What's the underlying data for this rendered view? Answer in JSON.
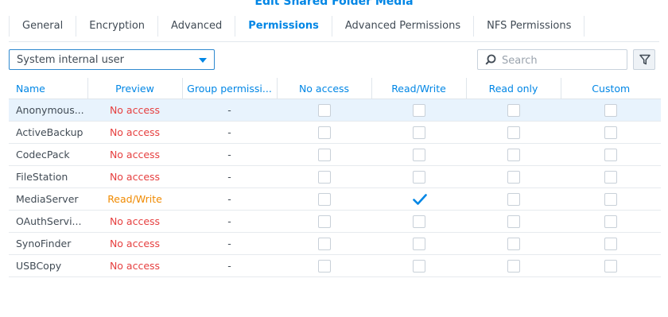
{
  "window": {
    "title": "Edit Shared Folder Media"
  },
  "tabs": [
    {
      "label": "General"
    },
    {
      "label": "Encryption"
    },
    {
      "label": "Advanced"
    },
    {
      "label": "Permissions",
      "active": true
    },
    {
      "label": "Advanced Permissions"
    },
    {
      "label": "NFS Permissions"
    }
  ],
  "toolbar": {
    "user_type": "System internal user",
    "search_placeholder": "Search"
  },
  "table": {
    "columns": [
      "Name",
      "Preview",
      "Group permissi...",
      "No access",
      "Read/Write",
      "Read only",
      "Custom"
    ],
    "rows": [
      {
        "name": "Anonymous...",
        "preview": "No access",
        "group": "-",
        "no_access": false,
        "read_write": false,
        "read_only": false,
        "custom": false
      },
      {
        "name": "ActiveBackup",
        "preview": "No access",
        "group": "-",
        "no_access": false,
        "read_write": false,
        "read_only": false,
        "custom": false
      },
      {
        "name": "CodecPack",
        "preview": "No access",
        "group": "-",
        "no_access": false,
        "read_write": false,
        "read_only": false,
        "custom": false
      },
      {
        "name": "FileStation",
        "preview": "No access",
        "group": "-",
        "no_access": false,
        "read_write": false,
        "read_only": false,
        "custom": false
      },
      {
        "name": "MediaServer",
        "preview": "Read/Write",
        "group": "-",
        "no_access": false,
        "read_write": true,
        "read_only": false,
        "custom": false
      },
      {
        "name": "OAuthServi...",
        "preview": "No access",
        "group": "-",
        "no_access": false,
        "read_write": false,
        "read_only": false,
        "custom": false
      },
      {
        "name": "SynoFinder",
        "preview": "No access",
        "group": "-",
        "no_access": false,
        "read_write": false,
        "read_only": false,
        "custom": false
      },
      {
        "name": "USBCopy",
        "preview": "No access",
        "group": "-",
        "no_access": false,
        "read_write": false,
        "read_only": false,
        "custom": false
      }
    ]
  },
  "colors": {
    "accent": "#0086e5",
    "no_access": "#e64040",
    "read_write": "#f08a00",
    "selected_row": "#e8f3fd"
  },
  "icons": {
    "dropdown": "caret-down-icon",
    "search": "search-icon",
    "filter": "filter-icon",
    "check": "checkmark-icon"
  }
}
